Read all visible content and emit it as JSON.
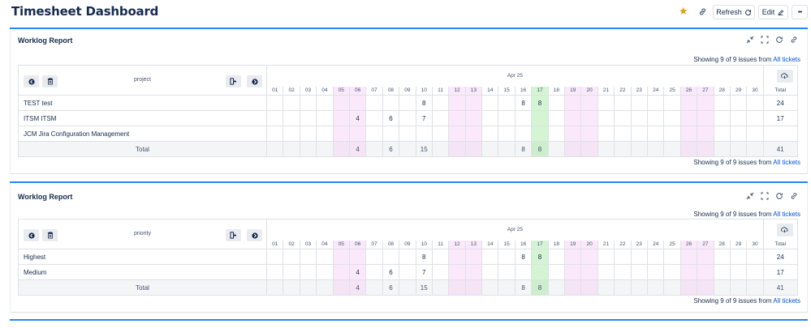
{
  "page": {
    "title": "Timesheet Dashboard",
    "refresh_label": "Refresh",
    "edit_label": "Edit",
    "more_label": "•••",
    "star_color": "#d4a017"
  },
  "gadgets": [
    {
      "title": "Worklog Report",
      "showing_prefix": "Showing 9 of 9 issues from",
      "showing_link": "All tickets",
      "group_field": "project",
      "month_label": "Apr 25",
      "total_col_label": "Total",
      "rows": [
        {
          "label": "TEST test",
          "total": "24"
        },
        {
          "label": "ITSM ITSM",
          "total": "17"
        },
        {
          "label": "JCM Jira Configuration Management",
          "total": ""
        }
      ],
      "total_row_label": "Total",
      "grand_total": "41"
    },
    {
      "title": "Worklog Report",
      "showing_prefix": "Showing 9 of 9 issues from",
      "showing_link": "All tickets",
      "group_field": "priority",
      "month_label": "Apr 25",
      "total_col_label": "Total",
      "rows": [
        {
          "label": "Highest",
          "total": "24"
        },
        {
          "label": "Medium",
          "total": "17"
        }
      ],
      "total_row_label": "Total",
      "grand_total": "41"
    }
  ],
  "days": [
    "01",
    "02",
    "03",
    "04",
    "05",
    "06",
    "07",
    "08",
    "09",
    "10",
    "11",
    "12",
    "13",
    "14",
    "15",
    "16",
    "17",
    "18",
    "19",
    "20",
    "21",
    "22",
    "23",
    "24",
    "25",
    "26",
    "27",
    "28",
    "29",
    "30"
  ],
  "weekend_days": [
    "05",
    "06",
    "12",
    "13",
    "19",
    "20",
    "26",
    "27"
  ],
  "today_day": "17",
  "cell_values": {
    "row_a": {
      "10": "8",
      "16": "8",
      "17": "8"
    },
    "row_b": {
      "06": "4",
      "08": "6",
      "10": "7"
    },
    "total": {
      "06": "4",
      "08": "6",
      "10": "15",
      "16": "8",
      "17": "8"
    }
  },
  "colors": {
    "accent": "#2684ff",
    "link": "#0052cc",
    "weekend": "#fbe9fb",
    "today": "#d4f4d4"
  }
}
